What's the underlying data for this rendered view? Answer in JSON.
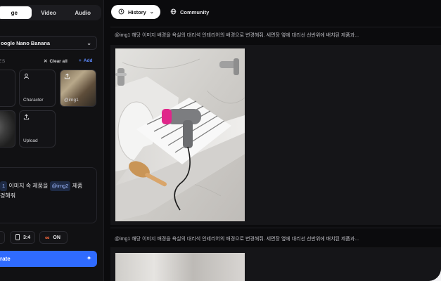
{
  "tabs": [
    {
      "label": "ge",
      "active": true
    },
    {
      "label": "Video",
      "active": false
    },
    {
      "label": "Audio",
      "active": false
    }
  ],
  "model": {
    "label": "oogle Nano Banana",
    "icon": "chevron-down-icon"
  },
  "images_header": {
    "label": "ES",
    "clear_label": "Clear all",
    "add_label": "Add"
  },
  "slots": [
    {
      "label": "Character",
      "icon": "person-icon"
    },
    {
      "label": "@img1",
      "icon": "upload-icon"
    },
    {
      "label": "Upload",
      "icon": "upload-icon"
    }
  ],
  "prompt": {
    "line1_chip": "1",
    "line1_text": " 이미지 속 제품을 ",
    "line1_chip2": "@img2",
    "line1_tail": " 제품",
    "line2": "경해줘"
  },
  "options": {
    "ratio": "3:4",
    "toggle": "ON"
  },
  "generate": {
    "label": "rate"
  },
  "header": {
    "history_label": "History",
    "community_label": "Community"
  },
  "feed": [
    {
      "caption": "@img1 해당 이미지 배경을 욕실의 대리석 인테리어의 배경으로 변경해줘. 세면장 옆에 대리선 선반위에 배치된 제품과..."
    },
    {
      "caption": "@img1 해당 이미지 배경을 욕실의 대리석 인테리어의 배경으로 변경해줘. 세면장 옆에 대리선 선반위에 배치된 제품과..."
    }
  ],
  "colors": {
    "accent": "#2f6bff",
    "background": "#0b0b0d",
    "panel": "#111113"
  }
}
